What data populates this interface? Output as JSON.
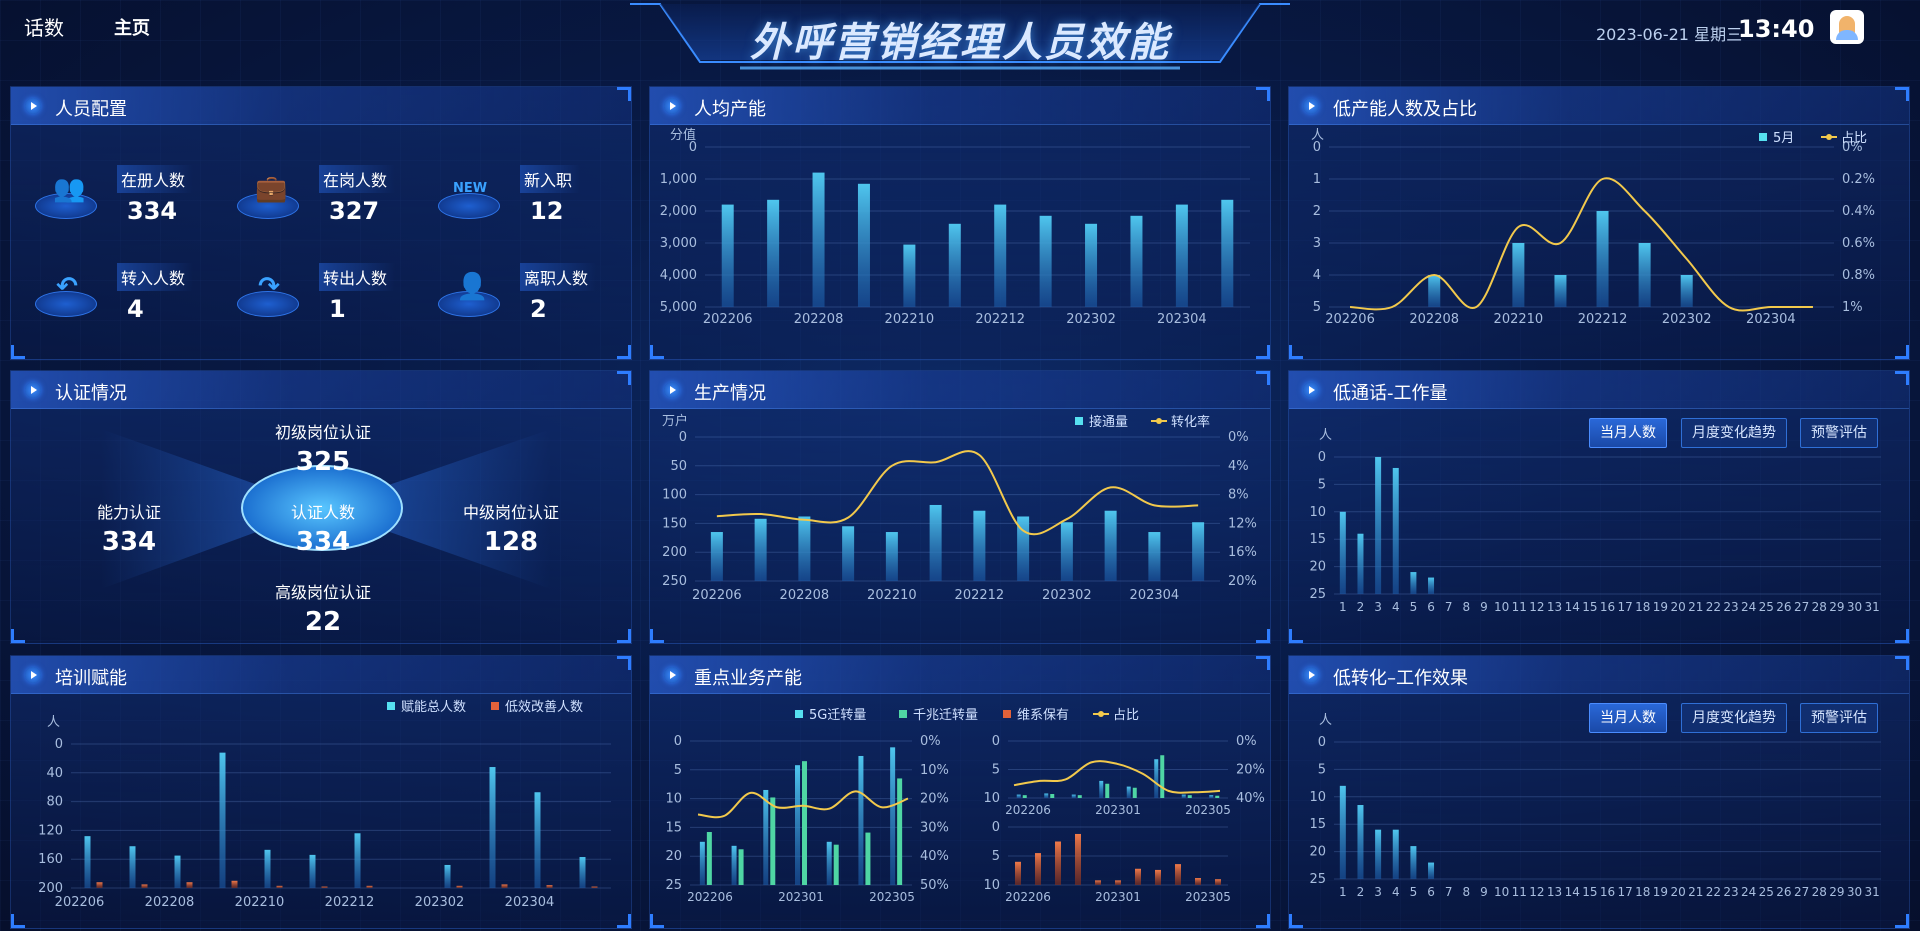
{
  "nav": {
    "item1": "话数",
    "item2": "主页"
  },
  "title": "外呼营销经理人员效能",
  "date": "2023-06-21 星期三",
  "time": "13:40",
  "colors": {
    "accent": "#2e7dff",
    "bar": "#3fb6e6",
    "line": "#f2c94c",
    "orange": "#e2623a",
    "green": "#4fd6a4"
  },
  "panels": {
    "staff": {
      "title": "人员配置",
      "items": [
        {
          "label": "在册人数",
          "value": "334",
          "icon": "people-icon"
        },
        {
          "label": "在岗人数",
          "value": "327",
          "icon": "briefcase-icon"
        },
        {
          "label": "新入职",
          "value": "12",
          "icon": "new-badge-icon"
        },
        {
          "label": "转入人数",
          "value": "4",
          "icon": "return-arrow-icon"
        },
        {
          "label": "转出人数",
          "value": "1",
          "icon": "forward-arrow-icon"
        },
        {
          "label": "离职人数",
          "value": "2",
          "icon": "user-leave-icon"
        }
      ]
    },
    "avg": {
      "title": "人均产能"
    },
    "low": {
      "title": "低产能人数及占比"
    },
    "cert": {
      "title": "认证情况",
      "center_label": "认证人数",
      "center_value": "334",
      "top_label": "初级岗位认证",
      "top_value": "325",
      "left_label": "能力认证",
      "left_value": "334",
      "right_label": "中级岗位认证",
      "right_value": "128",
      "bottom_label": "高级岗位认证",
      "bottom_value": "22"
    },
    "prod": {
      "title": "生产情况"
    },
    "lowcall": {
      "title": "低通话-工作量",
      "buttons": [
        "当月人数",
        "月度变化趋势",
        "预警评估"
      ]
    },
    "train": {
      "title": "培训赋能"
    },
    "key": {
      "title": "重点业务产能"
    },
    "lowconv": {
      "title": "低转化–工作效果",
      "buttons": [
        "当月人数",
        "月度变化趋势",
        "预警评估"
      ]
    }
  },
  "chart_data": [
    {
      "id": "avg",
      "type": "bar",
      "ylabel": "分值",
      "ylim": [
        0,
        5000
      ],
      "yticks": [
        "5,000",
        "4,000",
        "3,000",
        "2,000",
        "1,000",
        "0"
      ],
      "categories": [
        "202206",
        "202207",
        "202208",
        "202209",
        "202210",
        "202211",
        "202212",
        "202301",
        "202302",
        "202303",
        "202304",
        "202305"
      ],
      "xtick_labels": [
        "202206",
        "202208",
        "202210",
        "202212",
        "202302",
        "202304"
      ],
      "values": [
        3200,
        3350,
        4200,
        3850,
        1950,
        2600,
        3200,
        2850,
        2600,
        2850,
        3200,
        3350
      ]
    },
    {
      "id": "low",
      "type": "bar+line",
      "ylabel": "人",
      "ylim": [
        0,
        5
      ],
      "y2lim": [
        0,
        1
      ],
      "yticks": [
        "5",
        "4",
        "3",
        "2",
        "1",
        "0"
      ],
      "y2ticks": [
        "1%",
        "0.8%",
        "0.6%",
        "0.4%",
        "0.2%",
        "0%"
      ],
      "categories": [
        "202206",
        "202207",
        "202208",
        "202209",
        "202210",
        "202211",
        "202212",
        "202301",
        "202302",
        "202303",
        "202304",
        "202305"
      ],
      "xtick_labels": [
        "202206",
        "202208",
        "202210",
        "202212",
        "202302",
        "202304"
      ],
      "series": [
        {
          "name": "5月",
          "type": "bar",
          "values": [
            0,
            0,
            1,
            0,
            2,
            1,
            3,
            2,
            1,
            0,
            0,
            0
          ]
        },
        {
          "name": "占比",
          "type": "line",
          "values": [
            0,
            0,
            0.2,
            0,
            0.5,
            0.4,
            0.8,
            0.6,
            0.3,
            0,
            0,
            0
          ]
        }
      ]
    },
    {
      "id": "prod",
      "type": "bar+line",
      "ylabel": "万户",
      "ylim": [
        0,
        250
      ],
      "y2lim": [
        0,
        20
      ],
      "yticks": [
        "250",
        "200",
        "150",
        "100",
        "50",
        "0"
      ],
      "y2ticks": [
        "20%",
        "16%",
        "12%",
        "8%",
        "4%",
        "0%"
      ],
      "categories": [
        "202206",
        "202207",
        "202208",
        "202209",
        "202210",
        "202211",
        "202212",
        "202301",
        "202302",
        "202303",
        "202304",
        "202305"
      ],
      "xtick_labels": [
        "202206",
        "202208",
        "202210",
        "202212",
        "202302",
        "202304"
      ],
      "series": [
        {
          "name": "接通量",
          "type": "bar",
          "values": [
            85,
            108,
            112,
            95,
            85,
            132,
            122,
            112,
            102,
            122,
            85,
            102
          ]
        },
        {
          "name": "转化率",
          "type": "line",
          "values": [
            9,
            9.3,
            8.5,
            8.8,
            16,
            16.5,
            17.5,
            7,
            8.6,
            13,
            10.5,
            10.5
          ]
        }
      ]
    },
    {
      "id": "lowcall",
      "type": "bar",
      "ylabel": "人",
      "ylim": [
        0,
        25
      ],
      "yticks": [
        "25",
        "20",
        "15",
        "10",
        "5",
        "0"
      ],
      "categories": [
        "1",
        "2",
        "3",
        "4",
        "5",
        "6",
        "7",
        "8",
        "9",
        "10",
        "11",
        "12",
        "13",
        "14",
        "15",
        "16",
        "17",
        "18",
        "19",
        "20",
        "21",
        "22",
        "23",
        "24",
        "25",
        "26",
        "27",
        "28",
        "29",
        "30",
        "31"
      ],
      "values": [
        15,
        11,
        25,
        23,
        4,
        3,
        0,
        0,
        0,
        0,
        0,
        0,
        0,
        0,
        0,
        0,
        0,
        0,
        0,
        0,
        0,
        0,
        0,
        0,
        0,
        0,
        0,
        0,
        0,
        0,
        0
      ]
    },
    {
      "id": "train",
      "type": "bar",
      "ylabel": "人",
      "ylim": [
        0,
        200
      ],
      "yticks": [
        "200",
        "160",
        "120",
        "80",
        "40",
        "0"
      ],
      "categories": [
        "202206",
        "202207",
        "202208",
        "202209",
        "202210",
        "202211",
        "202212",
        "202301",
        "202302",
        "202303",
        "202304",
        "202305"
      ],
      "xtick_labels": [
        "202206",
        "202208",
        "202210",
        "202212",
        "202302",
        "202304"
      ],
      "series": [
        {
          "name": "赋能总人数",
          "values": [
            72,
            58,
            45,
            188,
            53,
            46,
            76,
            0,
            32,
            168,
            133,
            43
          ]
        },
        {
          "name": "低效改善人数",
          "values": [
            8,
            5,
            8,
            10,
            3,
            2,
            3,
            0,
            3,
            5,
            4,
            2
          ]
        }
      ]
    },
    {
      "id": "key_a",
      "type": "bar+line",
      "ylim": [
        0,
        25
      ],
      "y2lim": [
        0,
        50
      ],
      "yticks": [
        "25",
        "20",
        "15",
        "10",
        "5",
        "0"
      ],
      "y2ticks": [
        "50%",
        "40%",
        "30%",
        "20%",
        "10%",
        "0%"
      ],
      "xtick_labels": [
        "202206",
        "202301",
        "202305"
      ],
      "series": [
        {
          "name": "5G迁转量",
          "type": "bar",
          "values": [
            7.5,
            6.8,
            16.5,
            20.8,
            7.5,
            22.4,
            23.9
          ]
        },
        {
          "name": "千兆迁转量",
          "type": "bar",
          "values": [
            9.2,
            6.2,
            15.2,
            21.5,
            7.0,
            9.1,
            18.5
          ]
        },
        {
          "name": "占比",
          "type": "line",
          "values": [
            24.5,
            24,
            32,
            27,
            27.5,
            26.5,
            32.5,
            27,
            30
          ]
        }
      ]
    },
    {
      "id": "key_b",
      "type": "bar+line",
      "ylim": [
        0,
        10
      ],
      "y2lim": [
        0,
        40
      ],
      "yticks": [
        "10",
        "5",
        "0"
      ],
      "y2ticks": [
        "40%",
        "20%",
        "0%"
      ],
      "xtick_labels": [
        "202206",
        "202301",
        "202305"
      ],
      "series": [
        {
          "name": "5G迁转量",
          "type": "bar",
          "values": [
            0.6,
            0.8,
            0.6,
            3,
            2,
            6.8,
            0.6,
            0.5
          ]
        },
        {
          "name": "千兆迁转量",
          "type": "bar",
          "values": [
            0.5,
            0.7,
            0.5,
            2.5,
            1.8,
            7.5,
            0.5,
            0.4
          ]
        },
        {
          "name": "占比",
          "type": "line",
          "values": [
            9,
            12,
            13,
            25,
            24,
            17,
            5,
            4,
            5
          ]
        }
      ]
    },
    {
      "id": "key_c",
      "type": "bar",
      "ylim": [
        0,
        10
      ],
      "yticks": [
        "10",
        "5",
        "0"
      ],
      "xtick_labels": [
        "202206",
        "202301",
        "202305"
      ],
      "series": [
        {
          "name": "维系保有",
          "values": [
            4,
            5.5,
            7.5,
            8.8,
            0.8,
            0.8,
            2.8,
            2.6,
            3.6,
            1.2,
            1
          ]
        }
      ]
    },
    {
      "id": "lowconv",
      "type": "bar",
      "ylabel": "人",
      "ylim": [
        0,
        25
      ],
      "yticks": [
        "25",
        "20",
        "15",
        "10",
        "5",
        "0"
      ],
      "categories": [
        "1",
        "2",
        "3",
        "4",
        "5",
        "6",
        "7",
        "8",
        "9",
        "10",
        "11",
        "12",
        "13",
        "14",
        "15",
        "16",
        "17",
        "18",
        "19",
        "20",
        "21",
        "22",
        "23",
        "24",
        "25",
        "26",
        "27",
        "28",
        "29",
        "30",
        "31"
      ],
      "values": [
        17,
        13.5,
        9,
        9,
        6,
        3,
        0,
        0,
        0,
        0,
        0,
        0,
        0,
        0,
        0,
        0,
        0,
        0,
        0,
        0,
        0,
        0,
        0,
        0,
        0,
        0,
        0,
        0,
        0,
        0,
        0
      ]
    }
  ]
}
